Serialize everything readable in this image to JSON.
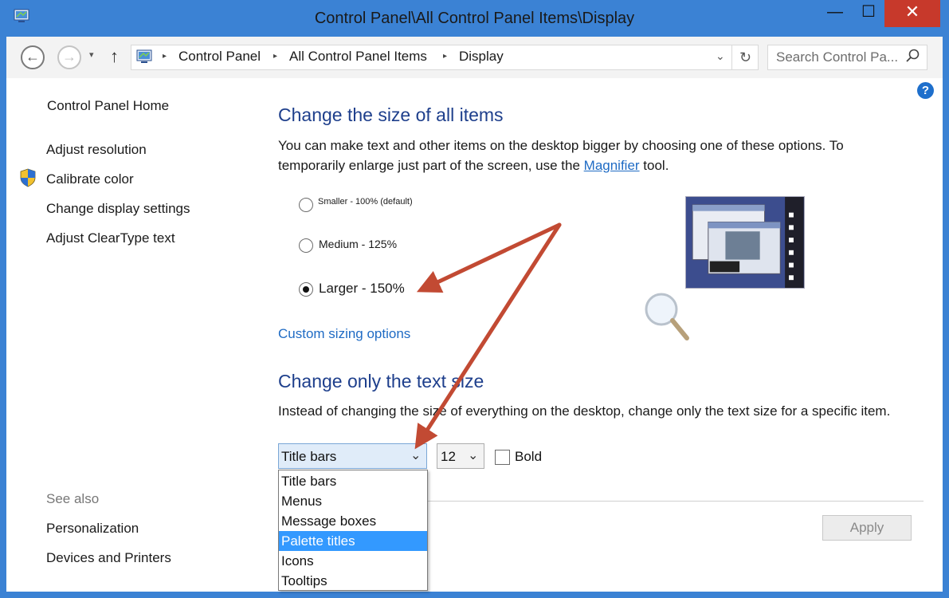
{
  "window": {
    "title": "Control Panel\\All Control Panel Items\\Display",
    "minimize_glyph": "—",
    "maximize_glyph": "☐",
    "close_glyph": "✕"
  },
  "nav": {
    "back_glyph": "←",
    "forward_glyph": "→",
    "history_glyph": "▾",
    "up_glyph": "↑",
    "breadcrumbs": [
      "Control Panel",
      "All Control Panel Items",
      "Display"
    ],
    "separator": "▸",
    "dropdown_glyph": "⌄",
    "refresh_glyph": "↻",
    "search_placeholder": "Search Control Pa..."
  },
  "sidebar": {
    "home": "Control Panel Home",
    "links": [
      "Adjust resolution",
      "Calibrate color",
      "Change display settings",
      "Adjust ClearType text"
    ],
    "see_also_label": "See also",
    "see_also": [
      "Personalization",
      "Devices and Printers"
    ]
  },
  "help_glyph": "?",
  "section_all_items": {
    "heading": "Change the size of all items",
    "text_before": "You can make text and other items on the desktop bigger by choosing one of these options. To temporarily enlarge just part of the screen, use the ",
    "link": "Magnifier",
    "text_after": " tool.",
    "options": [
      {
        "label": "Smaller - 100% (default)",
        "selected": false
      },
      {
        "label": "Medium - 125%",
        "selected": false
      },
      {
        "label": "Larger - 150%",
        "selected": true
      }
    ],
    "custom_link": "Custom sizing options"
  },
  "section_text_size": {
    "heading": "Change only the text size",
    "description": "Instead of changing the size of everything on the desktop, change only the text size for a specific item.",
    "item_select_value": "Title bars",
    "size_select_value": "12",
    "select_glyph": "⌄",
    "bold_label": "Bold",
    "bold_checked": false,
    "dropdown_options": [
      "Title bars",
      "Menus",
      "Message boxes",
      "Palette titles",
      "Icons",
      "Tooltips"
    ],
    "highlighted_option": "Palette titles"
  },
  "apply_label": "Apply",
  "colors": {
    "frame": "#3b82d4",
    "close": "#c7392b",
    "heading": "#1e3f8c",
    "link": "#1f6bc4",
    "selection": "#3399ff",
    "annotation_arrow": "#c24a33"
  }
}
